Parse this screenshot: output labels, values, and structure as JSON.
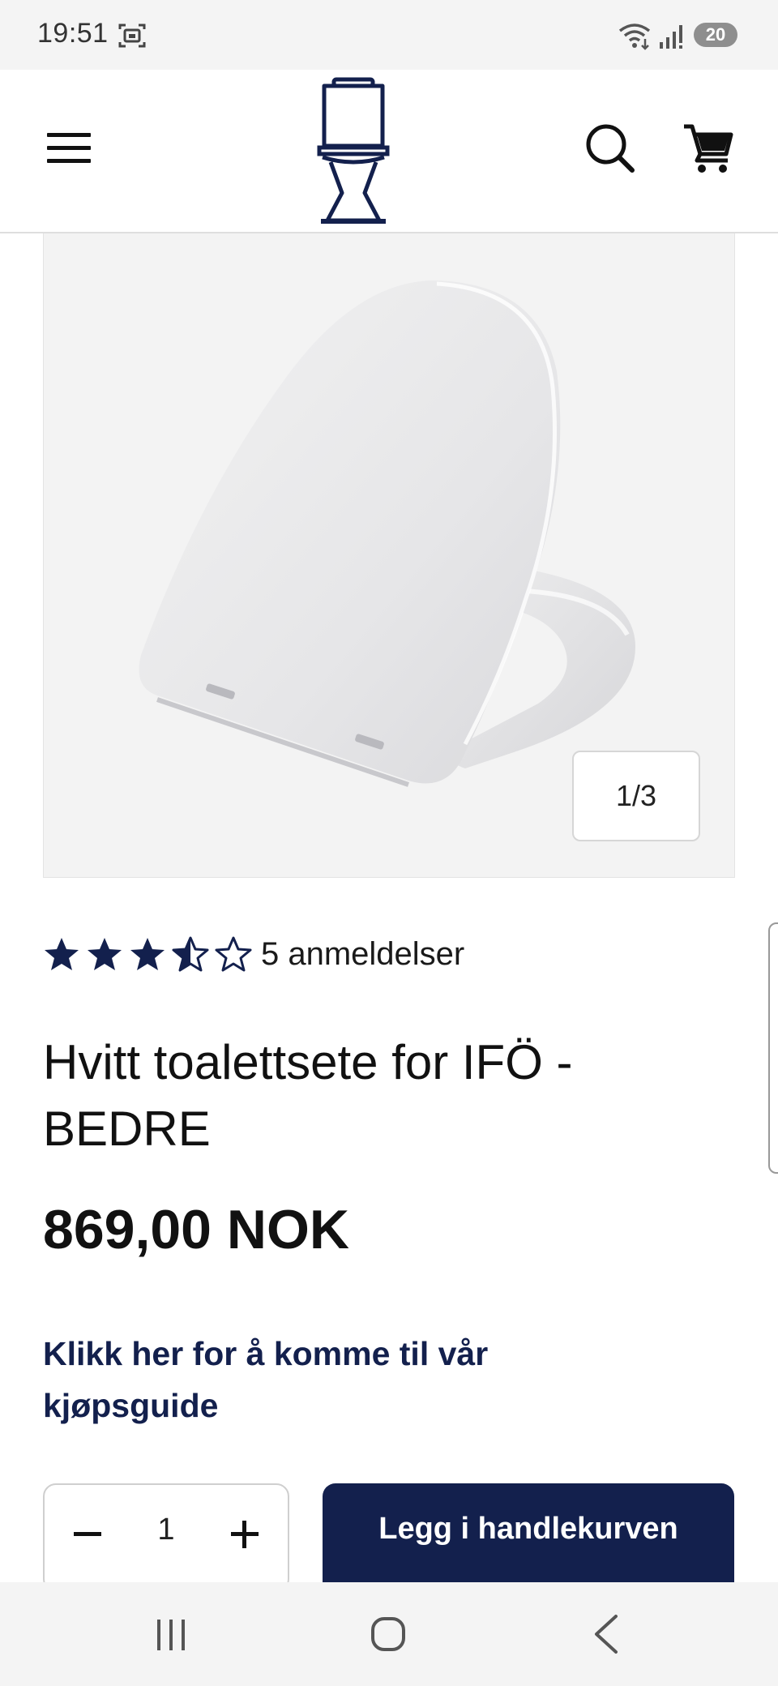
{
  "status_bar": {
    "time": "19:51",
    "battery": "20",
    "icons": [
      "screenshot-icon",
      "wifi-icon",
      "signal-icon",
      "battery-icon"
    ]
  },
  "header": {
    "icons": [
      "hamburger-menu-icon",
      "toilet-logo",
      "search-icon",
      "cart-icon"
    ],
    "brand_color": "#13204d"
  },
  "gallery": {
    "counter": "1/3",
    "current_image": 1,
    "total_images": 3
  },
  "product": {
    "rating_value": 3.5,
    "rating_max": 5,
    "review_count_text": "5 anmeldelser",
    "title": "Hvitt toalettsete for IFÖ - BEDRE",
    "price": "869,00 NOK",
    "guide_link": "Klikk her for å komme til vår kjøpsguide"
  },
  "purchase": {
    "quantity": "1",
    "add_to_cart_label": "Legg i handlekurven"
  },
  "navigation_bar": {
    "icons": [
      "recent-apps-icon",
      "home-icon",
      "back-icon"
    ]
  }
}
